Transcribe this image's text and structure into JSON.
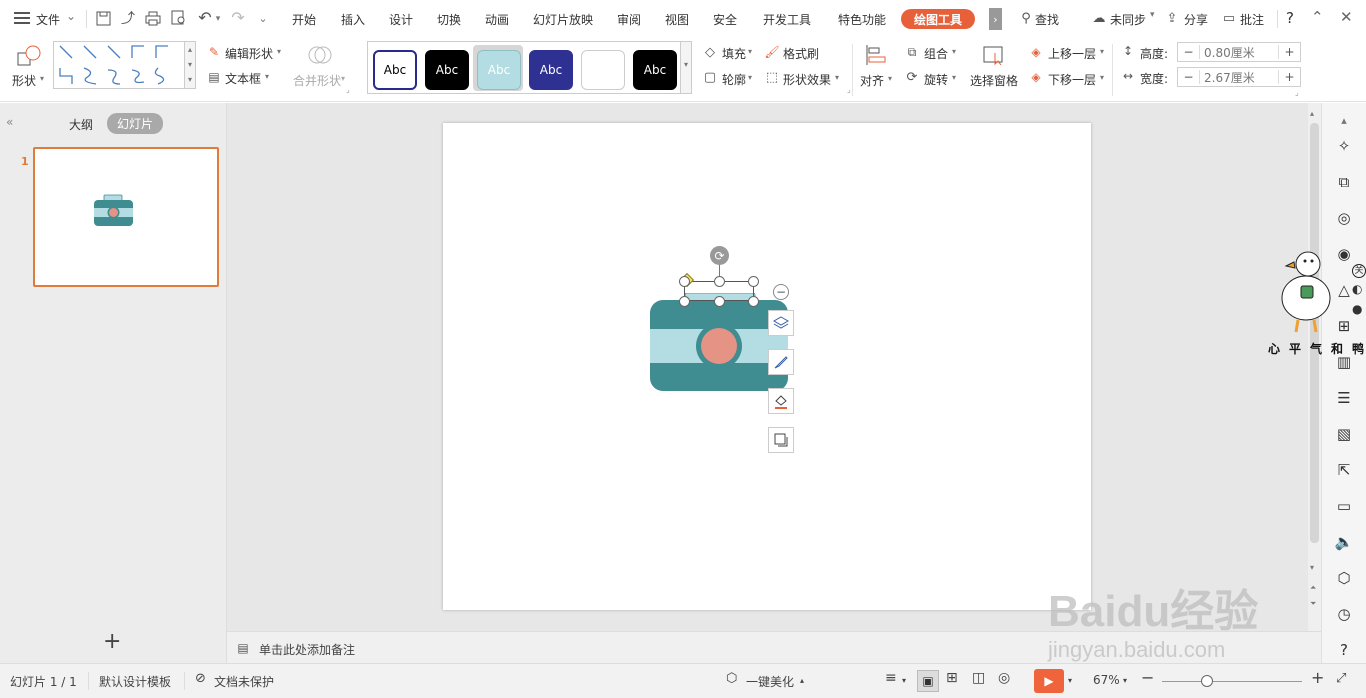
{
  "titlebar": {
    "menu_label": "文件",
    "tabs": [
      "开始",
      "插入",
      "设计",
      "切换",
      "动画",
      "幻灯片放映",
      "审阅",
      "视图",
      "安全",
      "开发工具",
      "特色功能"
    ],
    "active_tab": "绘图工具",
    "search": "查找",
    "sync": "未同步",
    "share": "分享",
    "comment": "批注",
    "help": "?"
  },
  "ribbon": {
    "shape_label": "形状",
    "edit_shape": "编辑形状",
    "textbox": "文本框",
    "merge_shape": "合并形状",
    "style_swatches": [
      {
        "text": "Abc",
        "bg": "#ffffff",
        "fg": "#000000",
        "border": "#2a2a8c"
      },
      {
        "text": "Abc",
        "bg": "#000000",
        "fg": "#ffffff",
        "border": "#000000"
      },
      {
        "text": "Abc",
        "bg": "#b3dde2",
        "fg": "#ffffff",
        "border": "#8fbfc5"
      },
      {
        "text": "Abc",
        "bg": "#2e3192",
        "fg": "#ffffff",
        "border": "#2e3192"
      },
      {
        "text": "",
        "bg": "#ffffff",
        "fg": "#000000",
        "border": "#cccccc"
      },
      {
        "text": "Abc",
        "bg": "#000000",
        "fg": "#ffffff",
        "border": "#000000"
      }
    ],
    "fill": "填充",
    "format_painter": "格式刷",
    "outline": "轮廓",
    "shape_effects": "形状效果",
    "align": "对齐",
    "group": "组合",
    "rotate": "旋转",
    "selection_pane": "选择窗格",
    "bring_forward": "上移一层",
    "send_backward": "下移一层",
    "height_label": "高度:",
    "height_value": "0.80厘米",
    "width_label": "宽度:",
    "width_value": "2.67厘米"
  },
  "leftpanel": {
    "outline_tab": "大纲",
    "slides_tab": "幻灯片",
    "slide_number": "1",
    "add": "+"
  },
  "notes": {
    "placeholder": "单击此处添加备注"
  },
  "watermark": {
    "caption": "心平气和鸭",
    "side_glyphs": [
      "关",
      "◐",
      "●"
    ],
    "brand": "Baidu经验",
    "url": "jingyan.baidu.com"
  },
  "status": {
    "slide_info": "幻灯片 1 / 1",
    "template": "默认设计模板",
    "protection": "文档未保护",
    "beautify": "一键美化",
    "zoom": "67%"
  },
  "colors": {
    "accent": "#e8603a",
    "teal": "#3f8c91",
    "light_teal": "#b3dde2",
    "salmon": "#e59384",
    "thumb_border": "#e07b39"
  }
}
